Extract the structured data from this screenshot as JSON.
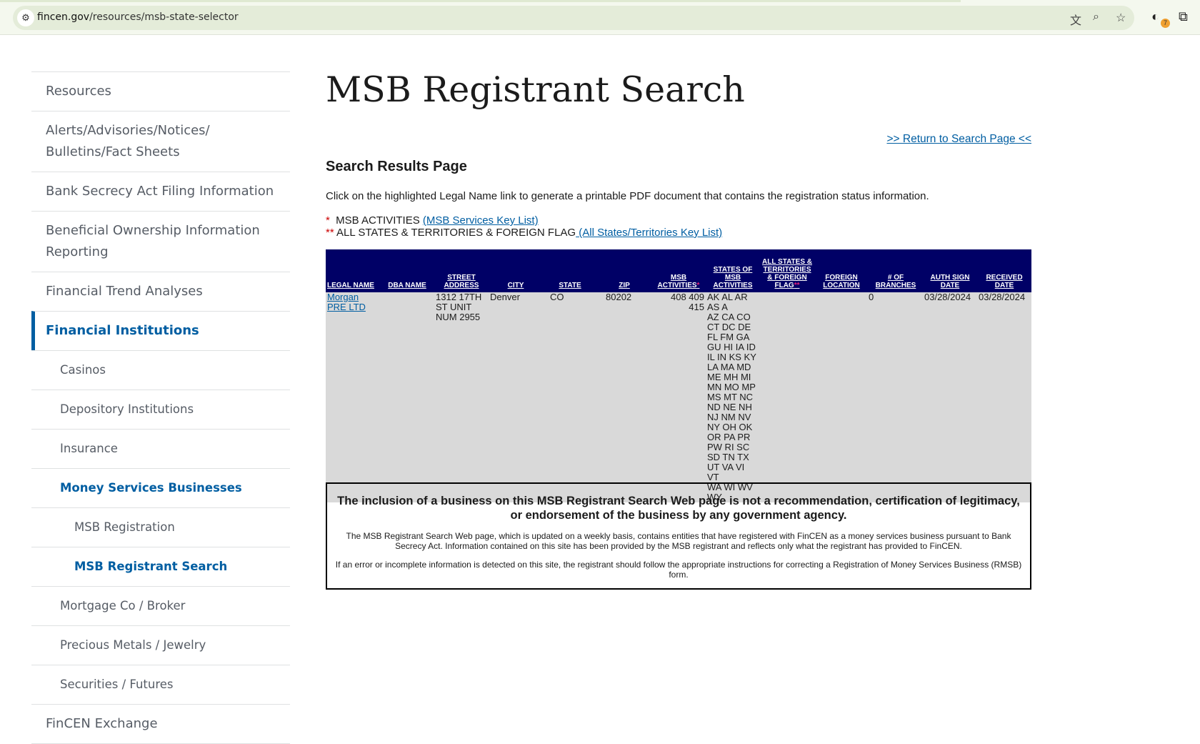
{
  "browser": {
    "url_domain": "fincen.gov",
    "url_path": "/resources/msb-state-selector",
    "extension_badge": "7"
  },
  "sidebar": {
    "items": [
      {
        "label": "Resources",
        "level": 1
      },
      {
        "label": "Alerts/Advisories/Notices/\nBulletins/Fact Sheets",
        "level": 1
      },
      {
        "label": "Bank Secrecy Act Filing Information",
        "level": 1
      },
      {
        "label": "Beneficial Ownership Information Reporting",
        "level": 1
      },
      {
        "label": "Financial Trend Analyses",
        "level": 1
      },
      {
        "label": "Financial Institutions",
        "level": 1
      },
      {
        "label": "Casinos",
        "level": 2
      },
      {
        "label": "Depository Institutions",
        "level": 2
      },
      {
        "label": "Insurance",
        "level": 2
      },
      {
        "label": "Money Services Businesses",
        "level": 2
      },
      {
        "label": "MSB Registration",
        "level": 3
      },
      {
        "label": "MSB Registrant Search",
        "level": 3
      },
      {
        "label": "Mortgage Co / Broker",
        "level": 2
      },
      {
        "label": "Precious Metals / Jewelry",
        "level": 2
      },
      {
        "label": "Securities / Futures",
        "level": 2
      },
      {
        "label": "FinCEN Exchange",
        "level": 1
      }
    ]
  },
  "main": {
    "title": "MSB Registrant Search",
    "return_link": ">> Return to Search Page <<",
    "subtitle": "Search Results Page",
    "instructions": "Click on the highlighted Legal Name link to generate a printable PDF document that contains the registration status information.",
    "key1": {
      "star": "*",
      "label": "  MSB ACTIVITIES ",
      "link": "(MSB Services Key List)"
    },
    "key2": {
      "star": "**",
      "label": " ALL STATES & TERRITORIES & FOREIGN FLAG",
      "link": " (All States/Territories Key List)"
    },
    "table": {
      "headers": [
        "LEGAL NAME",
        "DBA NAME",
        "STREET ADDRESS",
        "CITY",
        "STATE",
        "ZIP",
        "MSB ACTIVITIES",
        "STATES OF MSB ACTIVITIES",
        "ALL STATES & TERRITORIES & FOREIGN FLAG",
        "FOREIGN LOCATION",
        "# OF BRANCHES",
        "AUTH SIGN DATE",
        "RECEIVED DATE"
      ],
      "req1": "*",
      "req2": "**",
      "row": {
        "legal_name": "Morgan PRE LTD",
        "dba_name": "",
        "street": "1312 17TH ST UNIT NUM 2955",
        "city": "Denver",
        "state": "CO",
        "zip": "80202",
        "activities": "408 409 415",
        "states": "AK AL AR AS A\nAZ CA CO\nCT DC DE\nFL FM GA\nGU HI IA ID\nIL IN KS KY\nLA MA MD\nME MH MI\nMN MO MP\nMS MT NC\nND NE NH\nNJ NM NV\nNY OH OK\nOR PA PR\nPW RI SC\nSD TN TX\nUT VA VI VT\nWA WI WV\nWY",
        "all_states": "",
        "foreign_location": "",
        "branches": "0",
        "auth_sign_date": "03/28/2024",
        "received_date": "03/28/2024"
      }
    },
    "disclaimer": {
      "bold": "The inclusion of a business on this MSB Registrant Search Web page is not a recommendation, certification of legitimacy, or endorsement of the business by any government agency.",
      "p1": "The MSB Registrant Search Web page, which is updated on a weekly basis, contains entities that have registered with FinCEN as a money services business pursuant to Bank Secrecy Act. Information contained on this site has been provided by the MSB registrant and reflects only what the registrant has provided to FinCEN.",
      "p2": "If an error or incomplete information is detected on this site, the registrant should follow the appropriate instructions for correcting a Registration of Money Services Business (RMSB) form."
    }
  }
}
